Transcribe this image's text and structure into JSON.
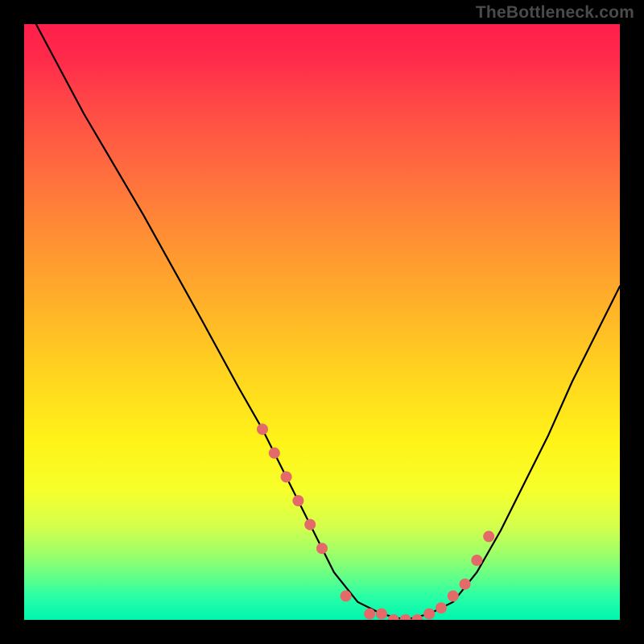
{
  "watermark": "TheBottleneck.com",
  "chart_data": {
    "type": "line",
    "title": "",
    "xlabel": "",
    "ylabel": "",
    "xlim": [
      0,
      100
    ],
    "ylim": [
      0,
      100
    ],
    "series": [
      {
        "name": "bottleneck-curve",
        "x": [
          2,
          10,
          20,
          30,
          36,
          40,
          44,
          48,
          52,
          56,
          60,
          64,
          68,
          72,
          76,
          80,
          84,
          88,
          92,
          96,
          100
        ],
        "values": [
          100,
          85,
          68,
          50,
          39,
          32,
          24,
          16,
          8,
          3,
          1,
          0,
          1,
          3,
          8,
          15,
          23,
          31,
          40,
          48,
          56
        ]
      }
    ],
    "markers": {
      "name": "highlight-points",
      "color": "#e46a6a",
      "x": [
        40,
        42,
        44,
        46,
        48,
        50,
        54,
        58,
        60,
        62,
        64,
        66,
        68,
        70,
        72,
        74,
        76,
        78
      ],
      "values": [
        32,
        28,
        24,
        20,
        16,
        12,
        4,
        1,
        1,
        0,
        0,
        0,
        1,
        2,
        4,
        6,
        10,
        14
      ]
    },
    "gradient_stops": [
      {
        "pos": 0,
        "color": "#ff1f4b"
      },
      {
        "pos": 50,
        "color": "#ffd21f"
      },
      {
        "pos": 80,
        "color": "#f7ff2a"
      },
      {
        "pos": 100,
        "color": "#00f5b0"
      }
    ]
  }
}
